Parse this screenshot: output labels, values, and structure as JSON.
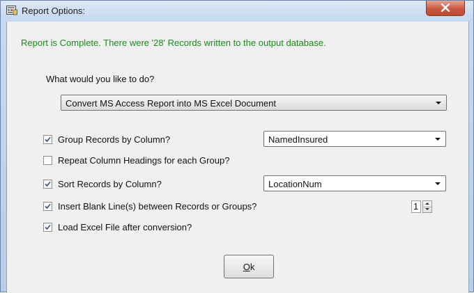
{
  "window": {
    "title": "Report Options:",
    "close_label": "X"
  },
  "status_message": "Report is Complete.  There were '28' Records written to the output database.",
  "question": "What would you like to do?",
  "action_select": {
    "value": "Convert MS Access Report into MS Excel Document"
  },
  "options": [
    {
      "label": "Group Records by Column?",
      "checked": true
    },
    {
      "label": "Repeat Column Headings for each Group?",
      "checked": false
    },
    {
      "label": "Sort Records by Column?",
      "checked": true
    },
    {
      "label": "Insert Blank Line(s) between Records or Groups?",
      "checked": true
    },
    {
      "label": "Load Excel File after conversion?",
      "checked": true
    }
  ],
  "group_by_select": {
    "value": "NamedInsured"
  },
  "sort_by_select": {
    "value": "LocationNum"
  },
  "blank_lines_spinner": {
    "value": "1"
  },
  "ok_button": {
    "mnemonic": "O",
    "rest": "k"
  },
  "colors": {
    "status_text": "#1a8a1a",
    "close_button": "#c9573f",
    "dialog_background": "#f0f0f0"
  },
  "icons": [
    "report-icon",
    "close-icon",
    "checkbox-check-icon",
    "dropdown-arrow-icon",
    "spin-up-icon",
    "spin-down-icon"
  ]
}
